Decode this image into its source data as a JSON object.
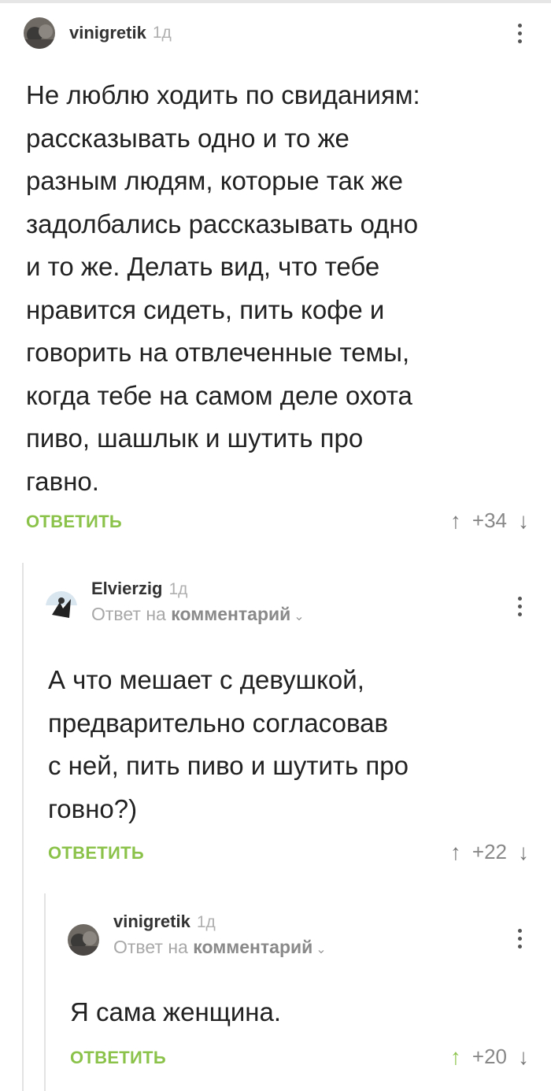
{
  "comments": [
    {
      "username": "vinigretik",
      "time": "1д",
      "text": "Не люблю ходить по свиданиям:\nрассказывать одно и то же\nразным людям, которые так же\nзадолбались рассказывать одно\nи то же. Делать вид, что тебе\nнравится сидеть, пить кофе и\nговорить на отвлеченные темы,\nкогда тебе на самом деле охота\nпиво, шашлык и шутить про\nгавно.",
      "reply_label": "ОТВЕТИТЬ",
      "score": "+34",
      "upvoted": false
    },
    {
      "username": "Elvierzig",
      "time": "1д",
      "reply_to_prefix": "Ответ на",
      "reply_to_target": "комментарий",
      "text": "А что мешает с девушкой,\nпредварительно согласовав\nс ней, пить пиво и шутить про\nговно?)",
      "reply_label": "ОТВЕТИТЬ",
      "score": "+22",
      "upvoted": false
    },
    {
      "username": "vinigretik",
      "time": "1д",
      "reply_to_prefix": "Ответ на",
      "reply_to_target": "комментарий",
      "text": "Я сама женщина.",
      "reply_label": "ОТВЕТИТЬ",
      "score": "+20",
      "upvoted": true
    }
  ],
  "icons": {
    "upvote": "arrow-up-icon",
    "downvote": "arrow-down-icon",
    "menu": "more-vertical-icon",
    "chevron": "chevron-down-icon"
  },
  "colors": {
    "accent_green": "#8bc34a",
    "thread_line": "#e3e3e3"
  }
}
